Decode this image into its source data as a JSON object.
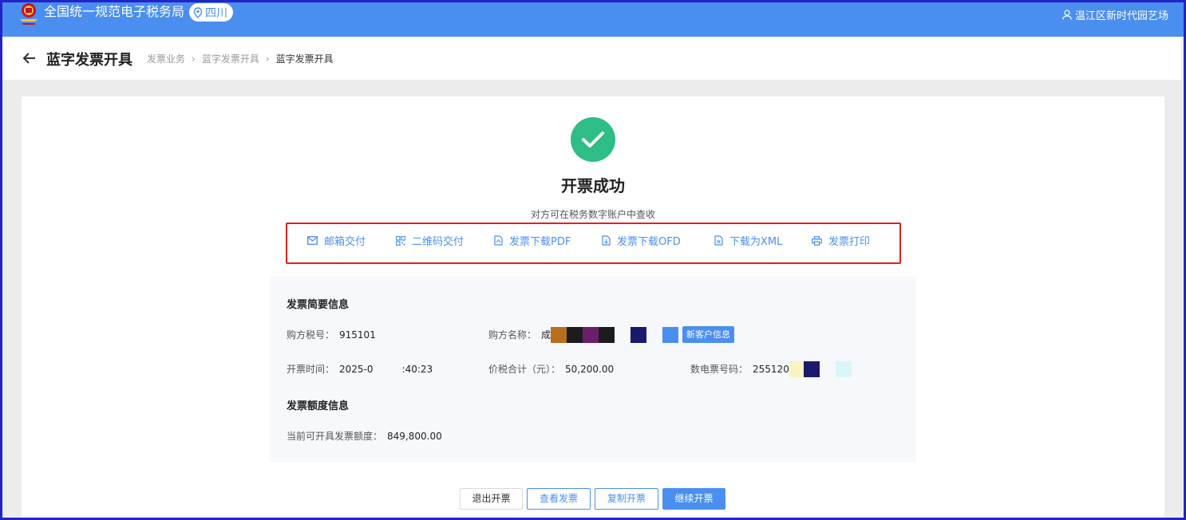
{
  "header": {
    "site_title": "全国统一规范电子税务局",
    "region": "四川",
    "user": "温江区新时代园艺场"
  },
  "breadcrumb_bar": {
    "page_title": "蓝字发票开具",
    "crumbs": [
      "发票业务",
      "蓝字发票开具",
      "蓝字发票开具"
    ]
  },
  "result": {
    "title": "开票成功",
    "subtitle": "对方可在税务数字账户中查收"
  },
  "actions": [
    {
      "label": "邮箱交付",
      "icon": "mail-icon"
    },
    {
      "label": "二维码交付",
      "icon": "qrcode-icon"
    },
    {
      "label": "发票下载PDF",
      "icon": "pdf-file-icon"
    },
    {
      "label": "发票下载OFD",
      "icon": "ofd-file-icon"
    },
    {
      "label": "下载为XML",
      "icon": "xml-file-icon"
    },
    {
      "label": "发票打印",
      "icon": "printer-icon"
    }
  ],
  "summary": {
    "title": "发票简要信息",
    "buyer_tax_no_label": "购方税号：",
    "buyer_tax_no": "915101",
    "buyer_name_label": "购方名称：",
    "buyer_name": "成",
    "new_customer_tag": "新客户信息",
    "issue_time_label": "开票时间：",
    "issue_time_a": "2025-0",
    "issue_time_b": ":40:23",
    "total_label": "价税合计（元）：",
    "total": "50,200.00",
    "invoice_no_label": "数电票号码：",
    "invoice_no": "255120"
  },
  "quota": {
    "title": "发票额度信息",
    "label": "当前可开具发票额度：",
    "value": "849,800.00"
  },
  "buttons": {
    "exit": "退出开票",
    "view": "查看发票",
    "copy": "复制开票",
    "continue": "继续开票"
  },
  "colors": {
    "header_blue": "#4a8ff0",
    "success_green": "#2ebd86",
    "highlight_red": "#e02020",
    "redaction_colors": [
      "#b86e1f",
      "#1c1c1c",
      "#6b1e6e",
      "#1a1a6c",
      "#4a8ff0",
      "#f7f4c2",
      "#d8f7fb"
    ]
  }
}
